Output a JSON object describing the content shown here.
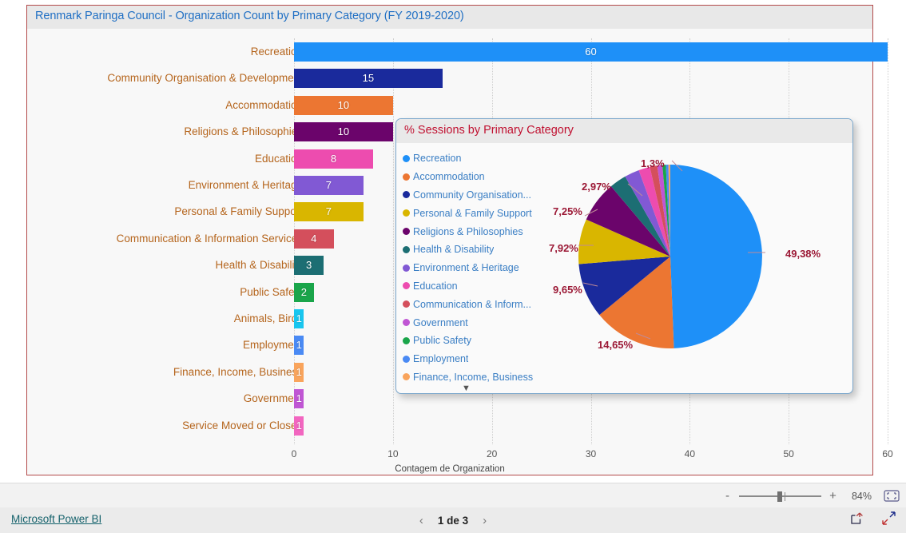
{
  "bar_visual": {
    "title": "Renmark Paringa Council - Organization Count by Primary Category (FY 2019-2020)"
  },
  "pie_visual": {
    "title": "% Sessions by Primary Category",
    "scroll_more_icon": "chevron-down-icon"
  },
  "toolbar": {
    "zoom_out_label": "-",
    "zoom_in_label": "+",
    "zoom_percent": "84%",
    "fit_icon": "fit-to-page-icon"
  },
  "footer": {
    "brand_link": "Microsoft Power BI",
    "prev_icon": "chevron-left-icon",
    "next_icon": "chevron-right-icon",
    "page_indicator": "1 de 3",
    "share_icon": "share-export-icon",
    "fullscreen_icon": "fullscreen-icon"
  },
  "chart_data": [
    {
      "type": "bar",
      "title": "Renmark Paringa Council - Organization Count by Primary Category (FY 2019-2020)",
      "orientation": "horizontal",
      "xlabel": "Contagem de Organization",
      "ylabel": "",
      "xlim": [
        0,
        60
      ],
      "xticks": [
        0,
        10,
        20,
        30,
        40,
        50,
        60
      ],
      "grid": true,
      "legend": "none",
      "categories": [
        "Recreation",
        "Community Organisation & Development",
        "Accommodation",
        "Religions & Philosophies",
        "Education",
        "Environment & Heritage",
        "Personal & Family Support",
        "Communication & Information Services",
        "Health & Disability",
        "Public Safety",
        "Animals, Birds",
        "Employment",
        "Finance, Income, Business",
        "Government",
        "Service Moved or Closed"
      ],
      "values": [
        60,
        15,
        10,
        10,
        8,
        7,
        7,
        4,
        3,
        2,
        1,
        1,
        1,
        1,
        1
      ],
      "colors": [
        "#1e90f8",
        "#1a2a9c",
        "#ec7632",
        "#6b046b",
        "#ed4caf",
        "#8159d4",
        "#d9b600",
        "#d44f5c",
        "#1c6e73",
        "#1aa54a",
        "#19c6ef",
        "#4a8af4",
        "#f9a košík"
      ]
    },
    {
      "type": "pie",
      "title": "% Sessions by Primary Category",
      "legend_position": "left",
      "labels": [
        "Recreation",
        "Accommodation",
        "Community Organisation...",
        "Personal & Family Support",
        "Religions & Philosophies",
        "Health & Disability",
        "Environment & Heritage",
        "Education",
        "Communication & Inform...",
        "Government",
        "Public Safety",
        "Employment",
        "Finance, Income, Business"
      ],
      "values": [
        49.38,
        14.65,
        9.65,
        7.92,
        7.25,
        2.97,
        2.6,
        2.0,
        1.3,
        0.9,
        0.6,
        0.45,
        0.33
      ],
      "visible_data_labels": [
        "49,38%",
        "14,65%",
        "9,65%",
        "7,92%",
        "7,25%",
        "2,97%",
        "1,3%"
      ],
      "colors": [
        "#1e90f8",
        "#ec7632",
        "#1a2a9c",
        "#d9b600",
        "#6b046b",
        "#1c6e73",
        "#8159d4",
        "#ed4caf",
        "#d44f5c",
        "#c056d4",
        "#1aa54a",
        "#4a8af4",
        "#f9a45c"
      ]
    }
  ]
}
